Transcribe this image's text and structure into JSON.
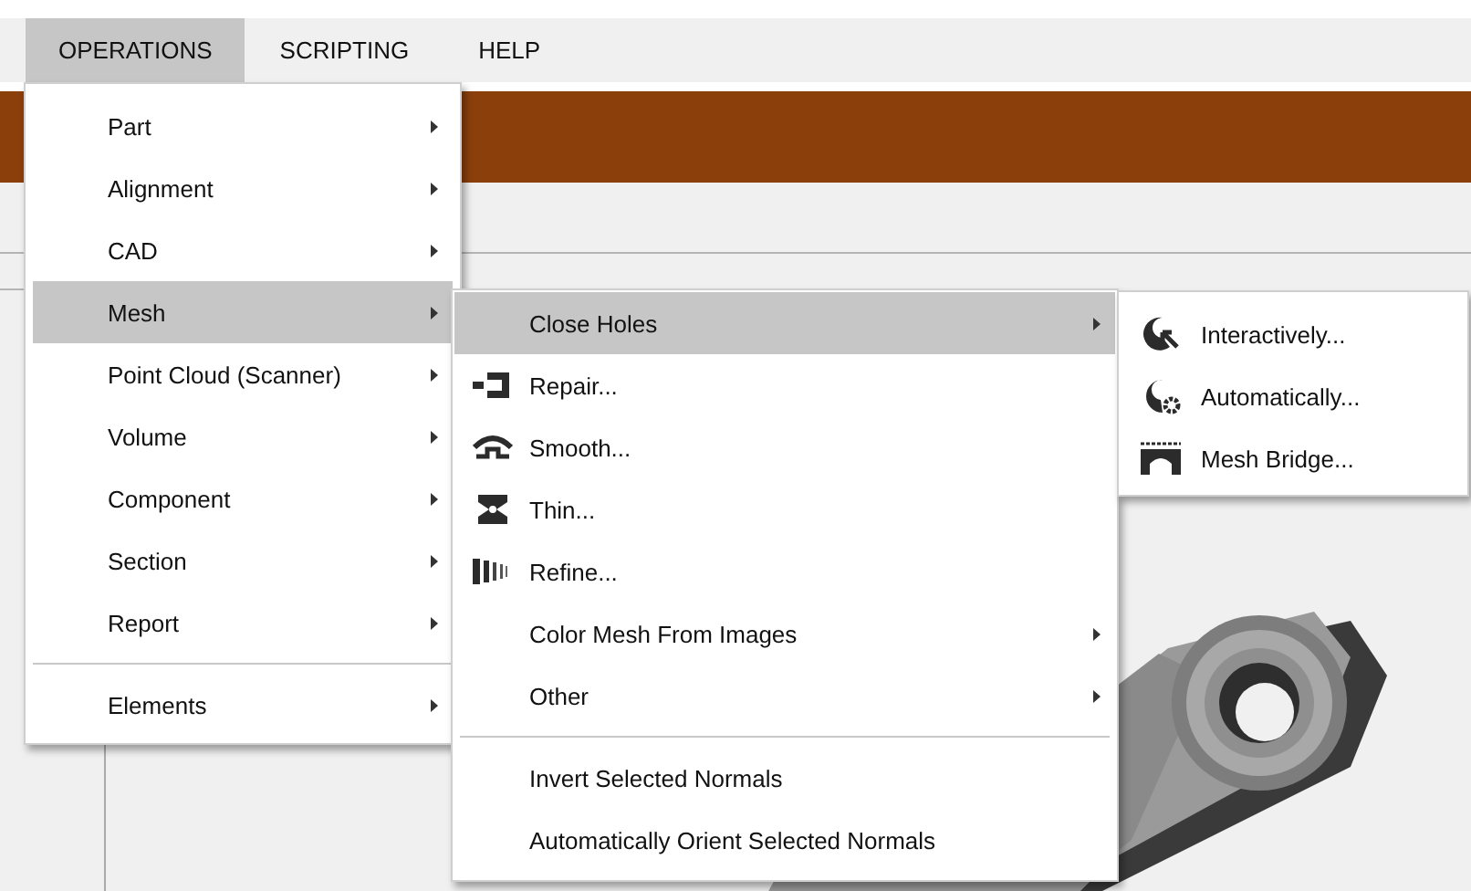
{
  "menubar": [
    {
      "label": "OPERATIONS",
      "selected": true
    },
    {
      "label": "SCRIPTING",
      "selected": false
    },
    {
      "label": "HELP",
      "selected": false
    }
  ],
  "menus": [
    {
      "items": [
        {
          "kind": "item",
          "label": "Part",
          "has_submenu": true,
          "selected": false
        },
        {
          "kind": "item",
          "label": "Alignment",
          "has_submenu": true,
          "selected": false
        },
        {
          "kind": "item",
          "label": "CAD",
          "has_submenu": true,
          "selected": false
        },
        {
          "kind": "item",
          "label": "Mesh",
          "has_submenu": true,
          "selected": true
        },
        {
          "kind": "item",
          "label": "Point Cloud (Scanner)",
          "has_submenu": true,
          "selected": false
        },
        {
          "kind": "item",
          "label": "Volume",
          "has_submenu": true,
          "selected": false
        },
        {
          "kind": "item",
          "label": "Component",
          "has_submenu": true,
          "selected": false
        },
        {
          "kind": "item",
          "label": "Section",
          "has_submenu": true,
          "selected": false
        },
        {
          "kind": "item",
          "label": "Report",
          "has_submenu": true,
          "selected": false
        },
        {
          "kind": "separator"
        },
        {
          "kind": "item",
          "label": "Elements",
          "has_submenu": true,
          "selected": false
        }
      ]
    },
    {
      "items": [
        {
          "kind": "item",
          "label": "Close Holes",
          "has_submenu": true,
          "selected": true
        },
        {
          "kind": "item",
          "label": "Repair...",
          "has_submenu": false,
          "selected": false
        },
        {
          "kind": "item",
          "label": "Smooth...",
          "has_submenu": false,
          "selected": false
        },
        {
          "kind": "item",
          "label": "Thin...",
          "has_submenu": false,
          "selected": false
        },
        {
          "kind": "item",
          "label": "Refine...",
          "has_submenu": false,
          "selected": false
        },
        {
          "kind": "item",
          "label": "Color Mesh From Images",
          "has_submenu": true,
          "selected": false
        },
        {
          "kind": "item",
          "label": "Other",
          "has_submenu": true,
          "selected": false
        },
        {
          "kind": "separator"
        },
        {
          "kind": "item",
          "label": "Invert Selected Normals",
          "has_submenu": false,
          "selected": false
        },
        {
          "kind": "item",
          "label": "Automatically Orient Selected Normals",
          "has_submenu": false,
          "selected": false
        }
      ]
    },
    {
      "items": [
        {
          "kind": "item",
          "label": "Interactively...",
          "has_submenu": false,
          "selected": false
        },
        {
          "kind": "item",
          "label": "Automatically...",
          "has_submenu": false,
          "selected": false
        },
        {
          "kind": "item",
          "label": "Mesh Bridge...",
          "has_submenu": false,
          "selected": false
        }
      ]
    }
  ]
}
